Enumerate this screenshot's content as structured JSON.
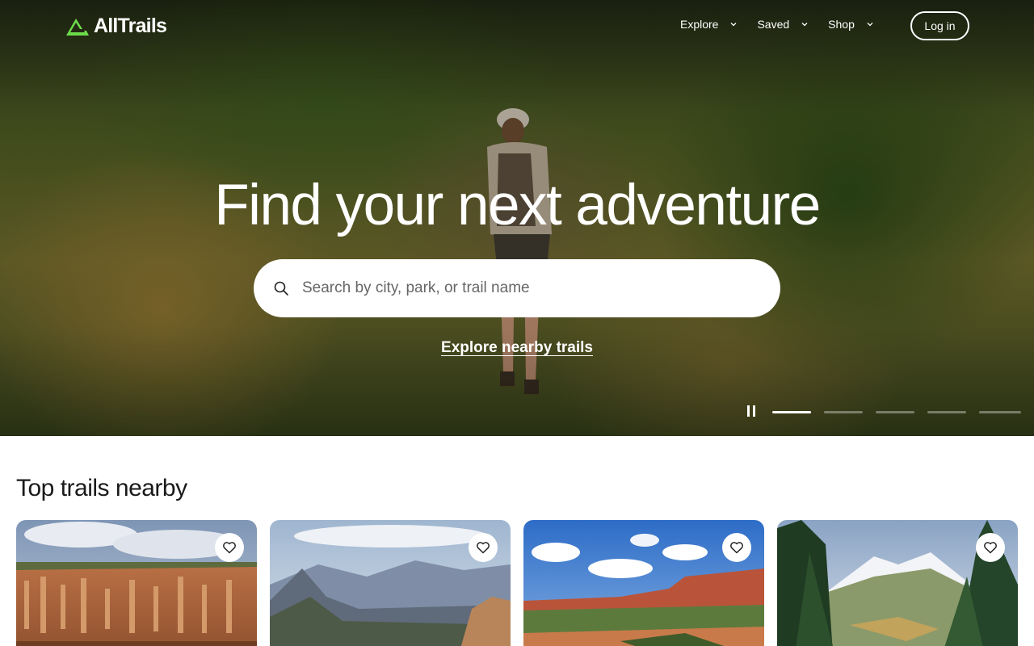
{
  "brand": {
    "name": "AllTrails",
    "accent": "#6ddc4b"
  },
  "nav": {
    "items": [
      {
        "label": "Explore"
      },
      {
        "label": "Saved"
      },
      {
        "label": "Shop"
      }
    ],
    "login_label": "Log in"
  },
  "hero": {
    "title": "Find your next adventure",
    "search_placeholder": "Search by city, park, or trail name",
    "explore_link": "Explore nearby trails",
    "slideshow": {
      "slides": 5,
      "active_slide": 1,
      "state": "playing"
    }
  },
  "section": {
    "title": "Top trails nearby"
  },
  "cards": [
    {
      "scene": "canyon-hoodoos",
      "favorite": false
    },
    {
      "scene": "mountain-valley",
      "favorite": false
    },
    {
      "scene": "red-rock-mesa",
      "favorite": false
    },
    {
      "scene": "alpine-forest",
      "favorite": false
    }
  ],
  "icons": [
    "logo-icon",
    "chevron-down-icon",
    "search-icon",
    "pause-icon",
    "heart-icon"
  ]
}
